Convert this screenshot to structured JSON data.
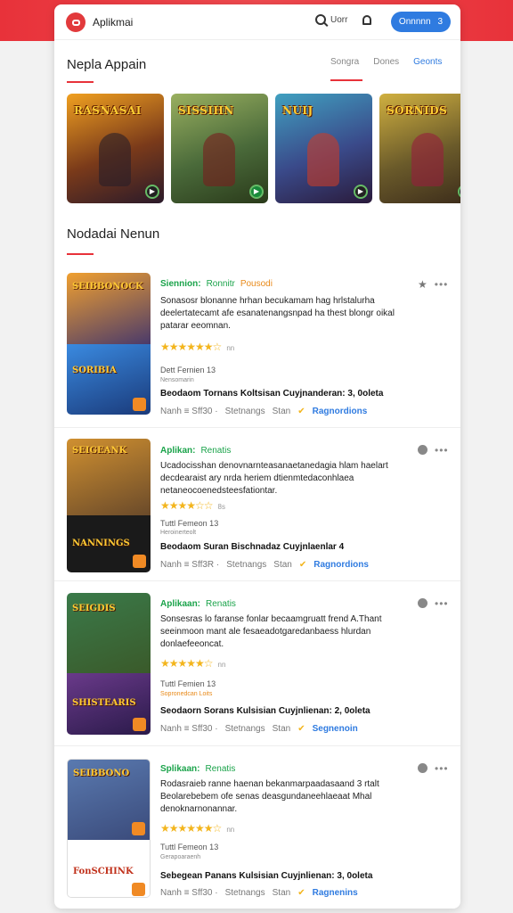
{
  "header": {
    "title": "Aplikmai",
    "search_label": "Uorr",
    "button_label": "Onnnnn",
    "button_count": "3"
  },
  "section1": {
    "title": "Nepla Appain",
    "tabs": [
      "Songra",
      "Dones",
      "Geonts"
    ]
  },
  "featured": [
    {
      "label": "RASNASAI",
      "bg": "#7a3a1a"
    },
    {
      "label": "SISSIHN",
      "bg": "#4a6a3a"
    },
    {
      "label": "NUIJ",
      "bg": "#3a4a8a"
    },
    {
      "label": "SORNIDS",
      "bg": "#6a5a2a"
    }
  ],
  "section2": {
    "title": "Nodadai Nenun"
  },
  "items": [
    {
      "name": "Siennion:",
      "sub": "Ronnitr",
      "tag": "Pousodi",
      "desc": "Sonasosr blonanne hrhan becukamam hag hrlstalurha deelertatecamt afe esanatenangsnpad ha thest blongr oikal patarar eeomnan.",
      "stars": "★★★★★★☆",
      "rating_meta": "nn",
      "line1": "Dett Fernien 13",
      "line2": "Nensomarin",
      "bold": "Beodaom Tornans Koltsisan Cuyjnanderan: 3, 0oleta",
      "bottom": [
        "Nanh ≡ Sff30 ·",
        "Stetnangs",
        "Stan"
      ],
      "link": "Ragnordions",
      "thumb_top": "SEIBBONOCK",
      "thumb_bot": "SORIBIA",
      "c1": "#4a3a6a",
      "c2": "#1a3a7a"
    },
    {
      "name": "Aplikan:",
      "sub": "Renatis",
      "tag": "",
      "desc": "Ucadocisshan denovnarnteasanaetanedagia hlam haelart decdearaist ary nrda heriem dtienmtedaconhlaea netaneocoenedsteesfationtar.",
      "stars": "★★★★☆☆",
      "rating_meta": "8s",
      "line1": "Tuttl Femeon 13",
      "line2": "Heroinerteolt",
      "bold": "Beodaom Suran Bischnadaz Cuyjnlaenlar 4",
      "bottom": [
        "Nanh ≡ Sff3R ·",
        "Stetnangs",
        "Stan"
      ],
      "link": "Ragnordions",
      "thumb_top": "SEIGEANK",
      "thumb_bot": "NANNINGS",
      "c1": "#6a4a2a",
      "c2": "#1a1a1a"
    },
    {
      "name": "Aplikaan:",
      "sub": "Renatis",
      "tag": "",
      "desc": "Sonsesras lo faranse fonlar becaamgruatt frend A.Thant seeinmoon mant ale fesaeadotgaredanbaess hlurdan donlaefeeoncat.",
      "stars": "★★★★★☆",
      "rating_meta": "nn",
      "line1": "Tuttl Femien 13",
      "line2": "Sopronedcan Loits",
      "bold": "Seodaorn Sorans Kulsisian Cuyjnlienan: 2, 0oleta",
      "bottom": [
        "Nanh ≡ Sff30 ·",
        "Stetnangs",
        "Stan"
      ],
      "link": "Segnenoin",
      "thumb_top": "SEIGDIS",
      "thumb_bot": "SHISTEARIS",
      "c1": "#3a5a2a",
      "c2": "#2a1a4a"
    },
    {
      "name": "Splikaan:",
      "sub": "Renatis",
      "tag": "",
      "desc": "Rodasraieb ranne haenan bekanmarpaadasaand 3 rtalt Beolarebebem ofe senas deasgundaneehlaeaat Mhal denoknarnonannar.",
      "stars": "★★★★★★☆",
      "rating_meta": "nn",
      "line1": "Tuttl Femeon 13",
      "line2": "Gerapoaraenh",
      "bold": "Sebegean Panans Kulsisian Cuyjnlienan: 3, 0oleta",
      "bottom": [
        "Nanh ≡ Sff30 ·",
        "Stetnangs",
        "Stan"
      ],
      "link": "Ragnenins",
      "thumb_top": "SEIBBONO",
      "thumb_bot": "FonSCHINK",
      "c1": "#3a4a7a",
      "c2": "#ffffff"
    }
  ]
}
